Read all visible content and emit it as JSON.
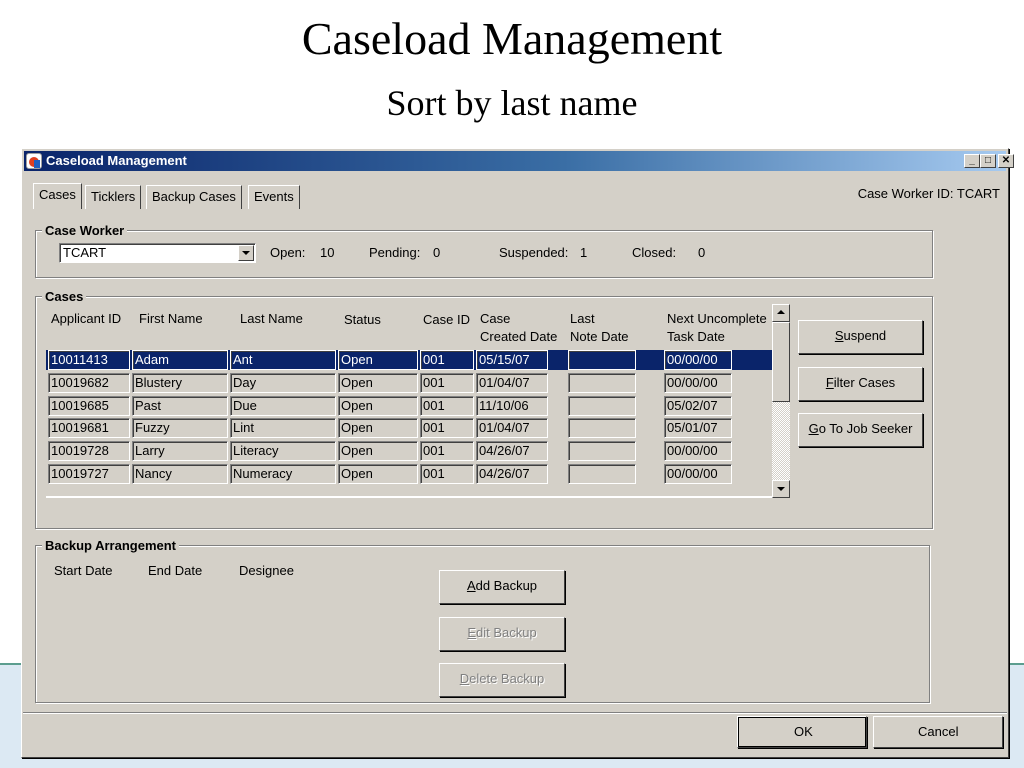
{
  "slide": {
    "title": "Caseload Management",
    "subtitle": "Sort by last name"
  },
  "window": {
    "title": "Caseload Management",
    "controls": {
      "minimize": "_",
      "maximize": "□",
      "close": "✕"
    }
  },
  "tabs": [
    {
      "label": "Cases",
      "active": true
    },
    {
      "label": "Ticklers",
      "active": false
    },
    {
      "label": "Backup Cases",
      "active": false
    },
    {
      "label": "Events",
      "active": false
    }
  ],
  "case_worker_id": "Case Worker ID: TCART",
  "case_worker": {
    "group_label": "Case Worker",
    "selected": "TCART",
    "open_label": "Open:",
    "open_value": "10",
    "pending_label": "Pending:",
    "pending_value": "0",
    "suspended_label": "Suspended:",
    "suspended_value": "1",
    "closed_label": "Closed:",
    "closed_value": "0"
  },
  "cases": {
    "group_label": "Cases",
    "headers": {
      "applicant_id": "Applicant ID",
      "first_name": "First Name",
      "last_name": "Last Name",
      "status": "Status",
      "case_id": "Case ID",
      "case_created_1": "Case",
      "case_created_2": "Created Date",
      "last_note_1": "Last",
      "last_note_2": "Note Date",
      "next_task_1": "Next Uncomplete",
      "next_task_2": "Task Date"
    },
    "rows": [
      {
        "applicant_id": "10011413",
        "first_name": "Adam",
        "last_name": "Ant",
        "status": "Open",
        "case_id": "001",
        "created": "05/15/07",
        "last_note": "",
        "next_task": "00/00/00",
        "selected": true
      },
      {
        "applicant_id": "10019682",
        "first_name": "Blustery",
        "last_name": "Day",
        "status": "Open",
        "case_id": "001",
        "created": "01/04/07",
        "last_note": "",
        "next_task": "00/00/00"
      },
      {
        "applicant_id": "10019685",
        "first_name": "Past",
        "last_name": "Due",
        "status": "Open",
        "case_id": "001",
        "created": "11/10/06",
        "last_note": "",
        "next_task": "05/02/07"
      },
      {
        "applicant_id": "10019681",
        "first_name": "Fuzzy",
        "last_name": "Lint",
        "status": "Open",
        "case_id": "001",
        "created": "01/04/07",
        "last_note": "",
        "next_task": "05/01/07"
      },
      {
        "applicant_id": "10019728",
        "first_name": "Larry",
        "last_name": "Literacy",
        "status": "Open",
        "case_id": "001",
        "created": "04/26/07",
        "last_note": "",
        "next_task": "00/00/00"
      },
      {
        "applicant_id": "10019727",
        "first_name": "Nancy",
        "last_name": "Numeracy",
        "status": "Open",
        "case_id": "001",
        "created": "04/26/07",
        "last_note": "",
        "next_task": "00/00/00"
      }
    ],
    "buttons": {
      "suspend_pre": "",
      "suspend_key": "S",
      "suspend_post": "uspend",
      "filter_pre": "",
      "filter_key": "F",
      "filter_post": "ilter Cases",
      "goto_pre": "",
      "goto_key": "G",
      "goto_post": "o To Job Seeker"
    }
  },
  "backup": {
    "group_label": "Backup Arrangement",
    "headers": {
      "start_date": "Start Date",
      "end_date": "End Date",
      "designee": "Designee"
    },
    "buttons": {
      "add_key": "A",
      "add_post": "dd Backup",
      "edit_key": "E",
      "edit_post": "dit Backup",
      "delete_key": "D",
      "delete_post": "elete Backup"
    }
  },
  "footer": {
    "ok_label": "OK",
    "cancel_label": "Cancel"
  }
}
